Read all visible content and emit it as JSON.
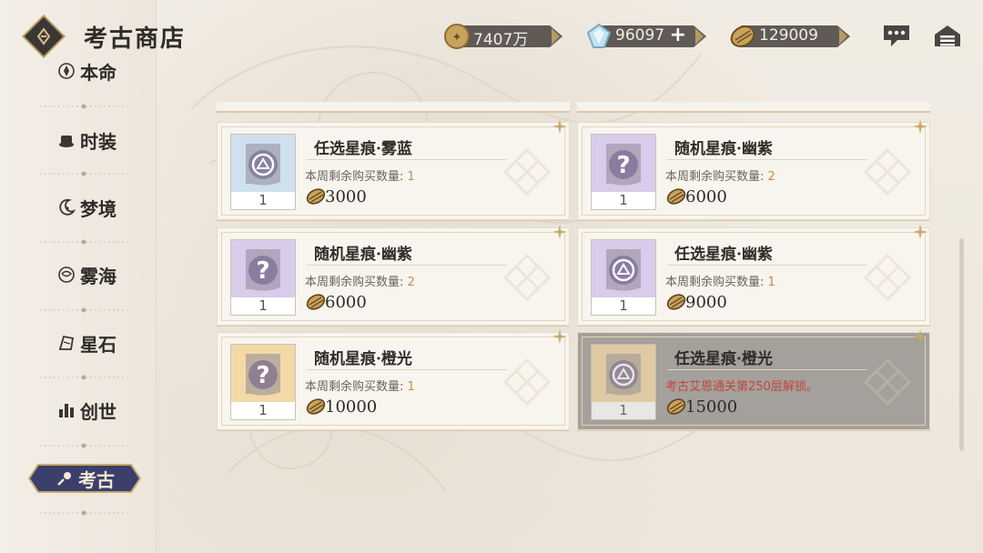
{
  "header": {
    "title": "考古商店"
  },
  "currencies": [
    {
      "name": "gold",
      "value": "7407万"
    },
    {
      "name": "crystal",
      "value": "96097",
      "add": "+"
    },
    {
      "name": "shell",
      "value": "129009"
    }
  ],
  "sidebar": {
    "items": [
      {
        "label": "本命",
        "icon": "lotus-icon"
      },
      {
        "label": "时装",
        "icon": "hat-icon"
      },
      {
        "label": "梦境",
        "icon": "moon-icon"
      },
      {
        "label": "雾海",
        "icon": "mist-icon"
      },
      {
        "label": "星石",
        "icon": "stone-icon"
      },
      {
        "label": "创世",
        "icon": "building-icon"
      },
      {
        "label": "考古",
        "icon": "shovel-icon",
        "active": true
      }
    ]
  },
  "shop": {
    "limit_label": "本周剩余购买数量:",
    "items": [
      {
        "name": "任选星痕·雾蓝",
        "qty": "1",
        "limit": "1",
        "price": "3000",
        "tint": "#cfe0ee",
        "glyph": "select"
      },
      {
        "name": "随机星痕·幽紫",
        "qty": "1",
        "limit": "2",
        "price": "6000",
        "tint": "#d9cbea",
        "glyph": "?"
      },
      {
        "name": "随机星痕·幽紫",
        "qty": "1",
        "limit": "2",
        "price": "6000",
        "tint": "#d9cbea",
        "glyph": "?"
      },
      {
        "name": "任选星痕·幽紫",
        "qty": "1",
        "limit": "1",
        "price": "9000",
        "tint": "#d9cbea",
        "glyph": "select"
      },
      {
        "name": "随机星痕·橙光",
        "qty": "1",
        "limit": "1",
        "price": "10000",
        "tint": "#f3d9a8",
        "glyph": "?"
      },
      {
        "name": "任选星痕·橙光",
        "qty": "1",
        "lock": "考古艾恩通关第250层解锁。",
        "price": "15000",
        "tint": "#f3d9a8",
        "glyph": "select",
        "locked": true
      }
    ]
  }
}
